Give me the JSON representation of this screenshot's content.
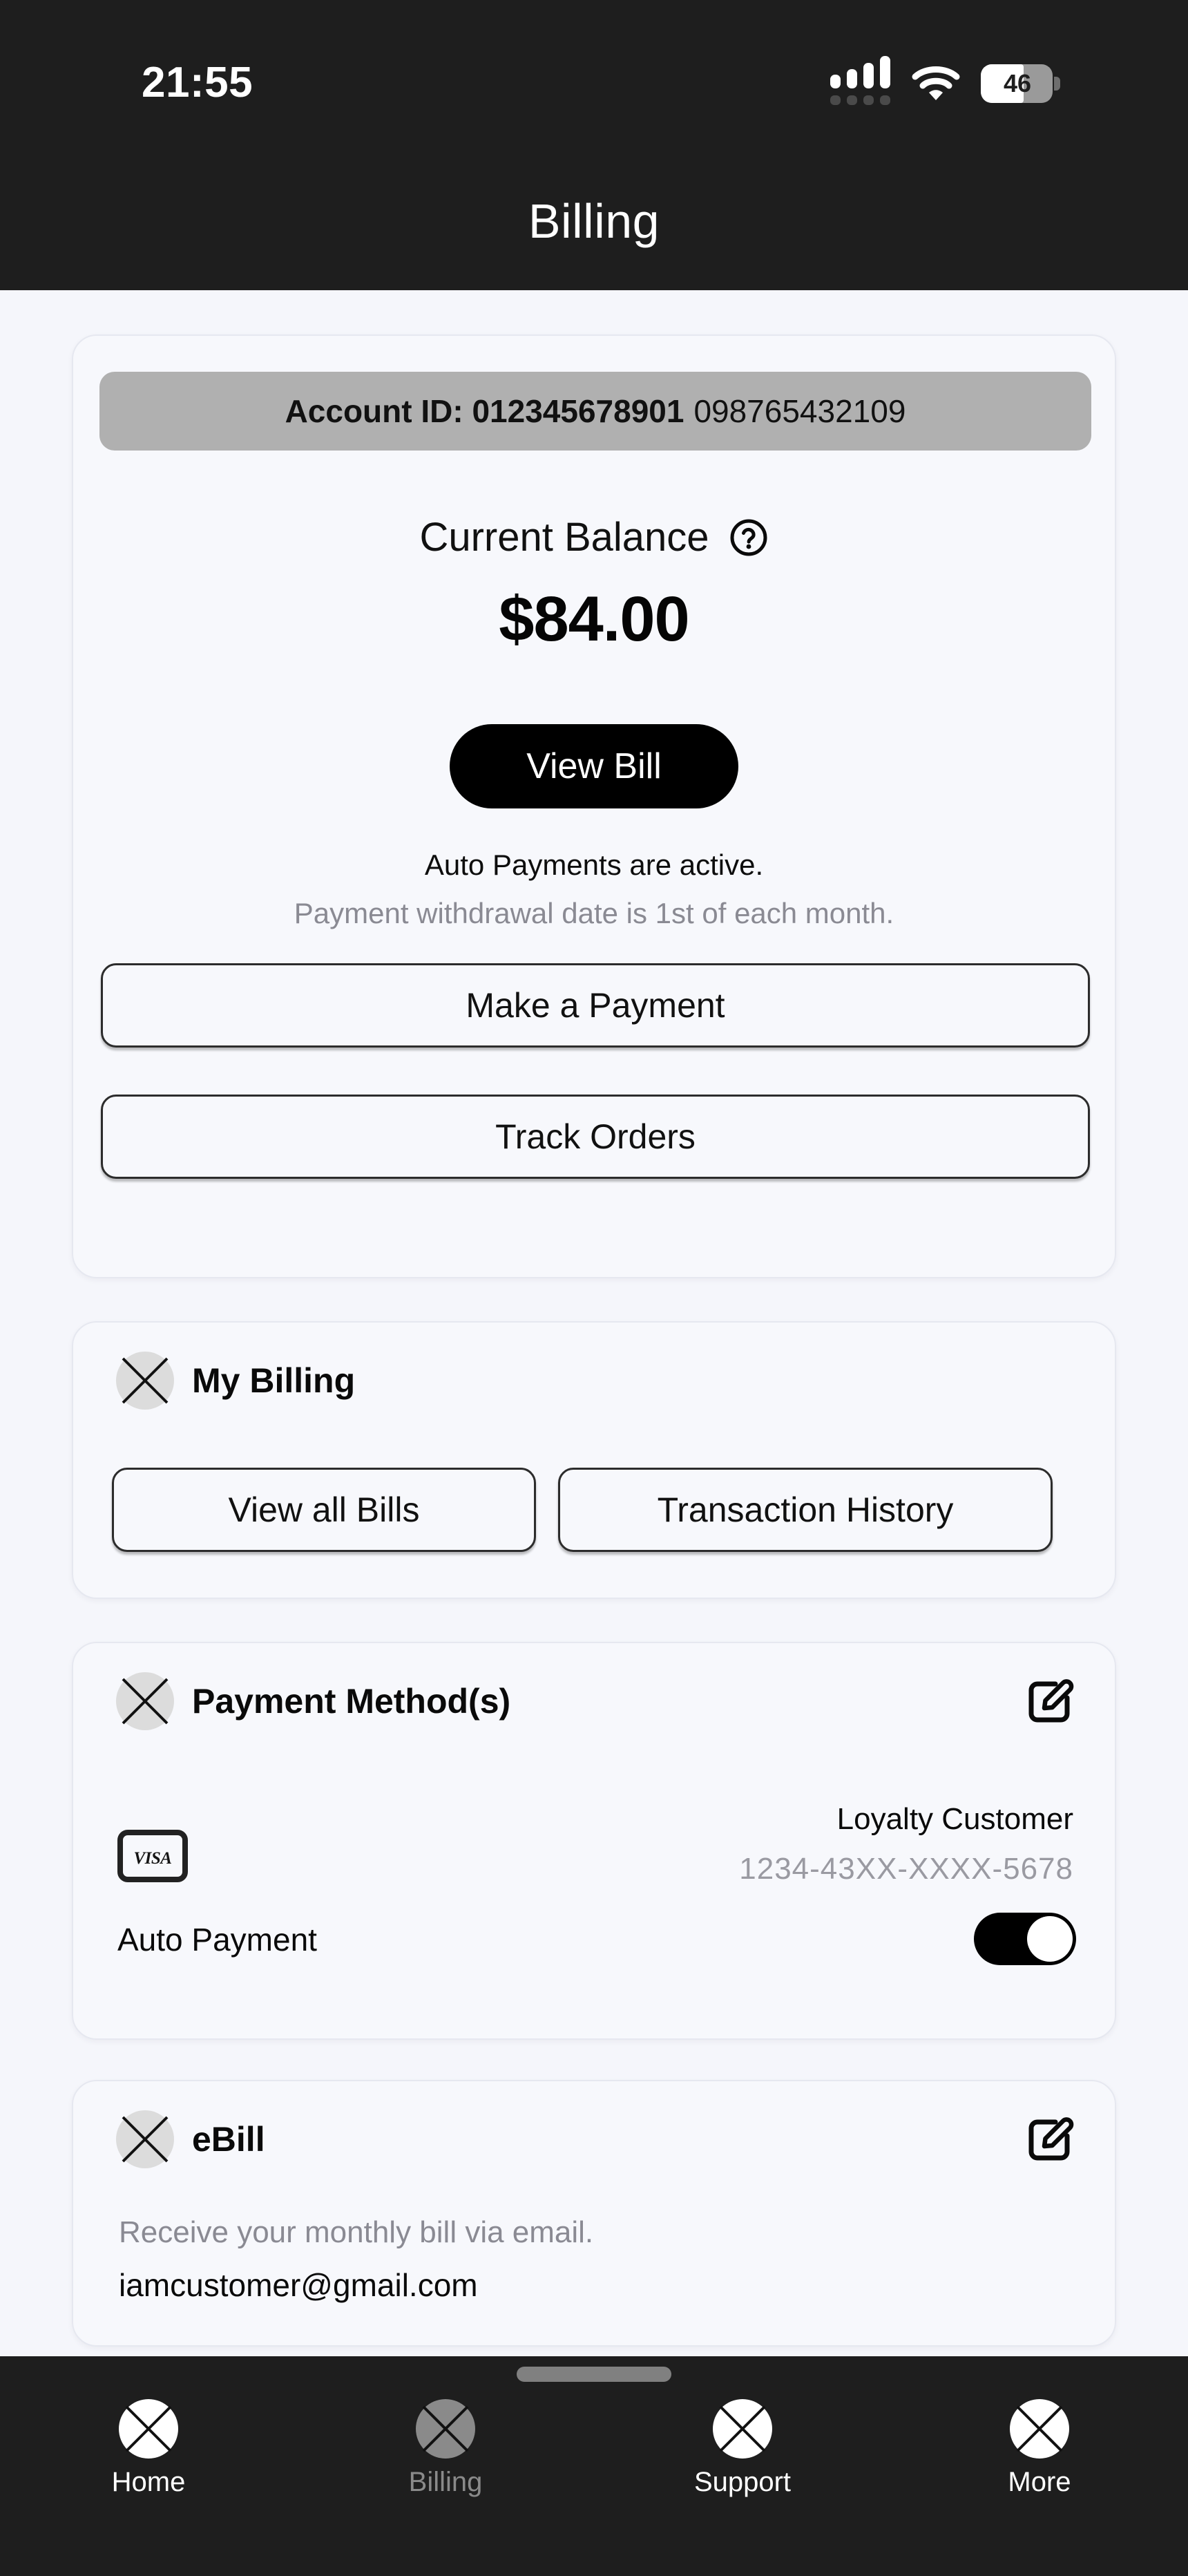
{
  "status_bar": {
    "time": "21:55",
    "battery_level": "46",
    "signal_icon": "cellular-signal-icon",
    "wifi_icon": "wifi-icon",
    "battery_icon": "battery-icon"
  },
  "header": {
    "title": "Billing"
  },
  "balance_card": {
    "account_label": "Account ID: 012345678901",
    "account_masked": "098765432109",
    "balance_label": "Current Balance",
    "help_icon": "question-mark-circle-icon",
    "balance_amount": "$84.00",
    "view_bill_label": "View Bill",
    "autopay_note": "Auto Payments are active.",
    "autopay_sub": "Payment withdrawal date is 1st of each month.",
    "make_payment_label": "Make a Payment",
    "track_orders_label": "Track Orders"
  },
  "my_billing": {
    "title": "My Billing",
    "icon": "placeholder-image-icon",
    "view_all_bills_label": "View all Bills",
    "transaction_history_label": "Transaction History"
  },
  "payment_methods": {
    "title": "Payment Method(s)",
    "icon": "placeholder-image-icon",
    "edit_icon": "edit-pencil-square-icon",
    "card_brand_icon": "visa-card-icon",
    "card_brand_text": "VISA",
    "holder_name": "Loyalty Customer",
    "card_number": "1234-43XX-XXXX-5678",
    "autopay_label": "Auto Payment",
    "autopay_enabled": true
  },
  "ebill": {
    "title": "eBill",
    "icon": "placeholder-image-icon",
    "edit_icon": "edit-pencil-square-icon",
    "description": "Receive your monthly bill via email.",
    "email": "iamcustomer@gmail.com"
  },
  "bottom_nav": {
    "items": [
      {
        "label": "Home",
        "icon": "home-icon",
        "active": false
      },
      {
        "label": "Billing",
        "icon": "billing-icon",
        "active": true
      },
      {
        "label": "Support",
        "icon": "support-icon",
        "active": false
      },
      {
        "label": "More",
        "icon": "more-icon",
        "active": false
      }
    ]
  },
  "colors": {
    "background": "#F5F6FB",
    "card": "#F7F8FC",
    "bar": "#1E1E1E",
    "accent": "#000000",
    "muted_text": "#8A8A93",
    "pill": "#B0B0B0"
  }
}
